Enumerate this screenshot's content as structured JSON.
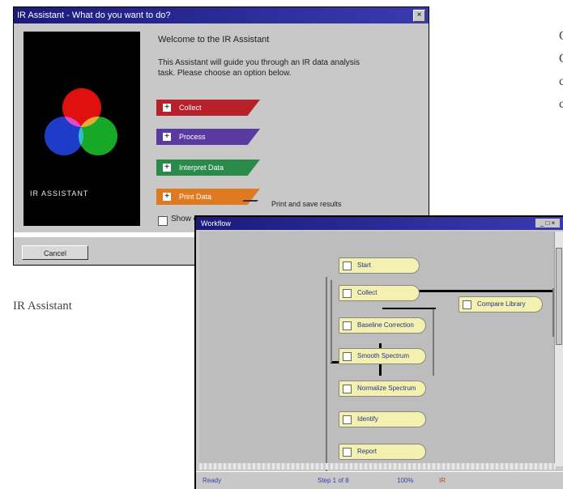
{
  "caption": "IR Assistant",
  "side_text": [
    "C",
    "C",
    "c",
    "c"
  ],
  "dialog": {
    "title": "IR Assistant - What do you want to do?",
    "close_glyph": "×",
    "heading": "Welcome to the IR Assistant",
    "description": "This Assistant will guide you through an IR data analysis task. Please choose an option below.",
    "art_label": "IR ASSISTANT",
    "options": [
      {
        "label": "Collect",
        "color": "#b8202a"
      },
      {
        "label": "Process",
        "color": "#5a3aa0"
      },
      {
        "label": "Interpret Data",
        "color": "#2a8a4a"
      },
      {
        "label": "Print Data",
        "color": "#e07a20"
      }
    ],
    "option_note": "Print and save results",
    "checkbox_label": "Show on startup",
    "cancel_label": "Cancel"
  },
  "flow_window": {
    "title": "Workflow",
    "title_buttons": "_ □ ×",
    "nodes": [
      {
        "label": "Start"
      },
      {
        "label": "Collect"
      },
      {
        "label": "Baseline Correction"
      },
      {
        "label": "Smooth Spectrum"
      },
      {
        "label": "Normalize Spectrum"
      },
      {
        "label": "Identify"
      },
      {
        "label": "Report"
      },
      {
        "label": "Compare Library"
      }
    ],
    "status": [
      "Ready",
      "Step 1 of 8",
      "100%",
      "IR"
    ]
  }
}
